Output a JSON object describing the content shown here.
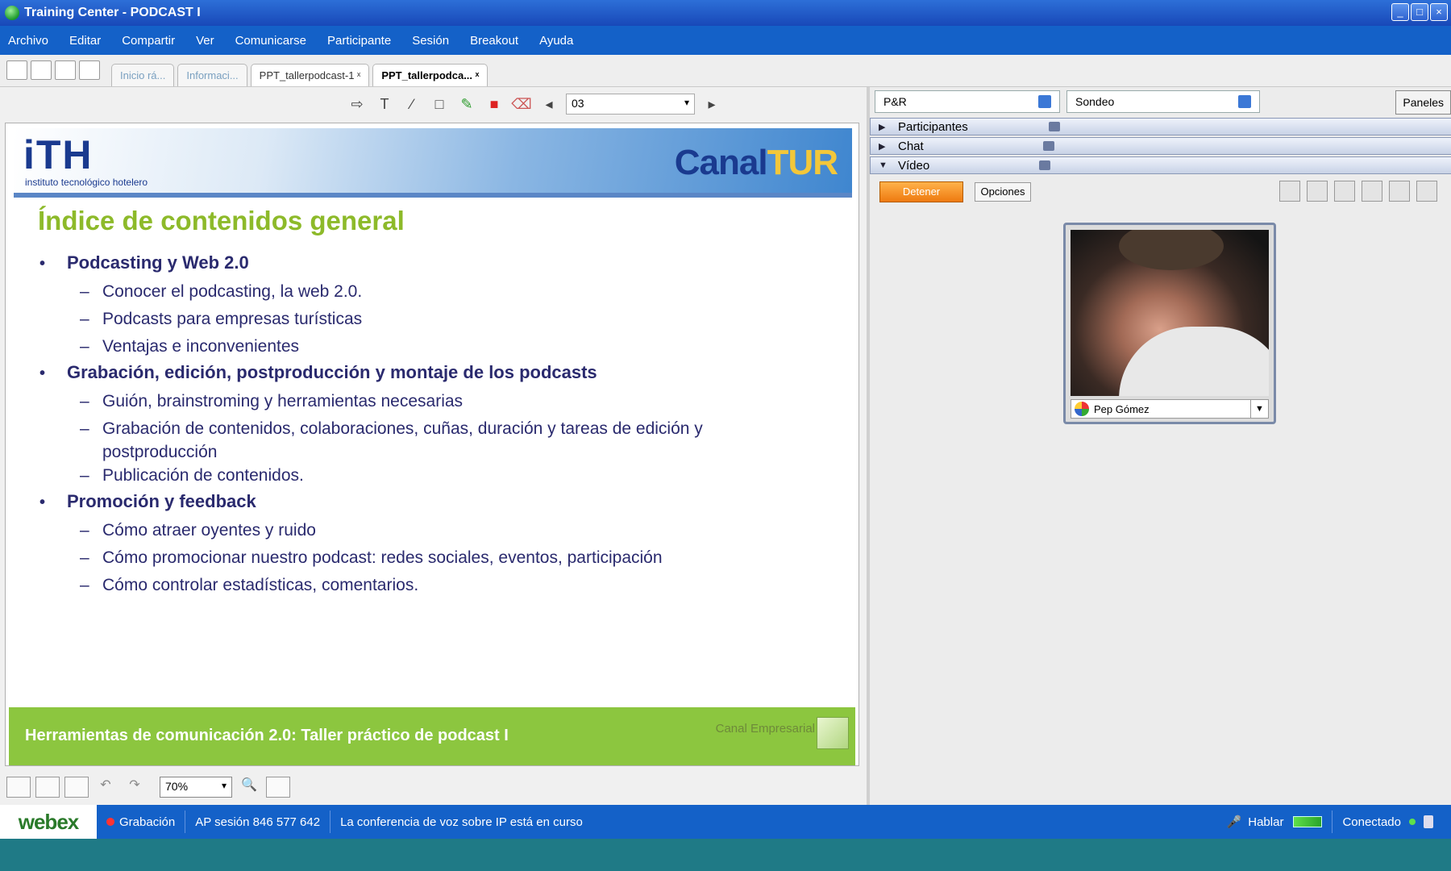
{
  "window": {
    "title": "Training Center - PODCAST I"
  },
  "menu": [
    "Archivo",
    "Editar",
    "Compartir",
    "Ver",
    "Comunicarse",
    "Participante",
    "Sesión",
    "Breakout",
    "Ayuda"
  ],
  "tabs": [
    {
      "label": "Inicio rá...",
      "state": "dim"
    },
    {
      "label": "Informaci...",
      "state": "dim"
    },
    {
      "label": "PPT_tallerpodcast-1 ˣ",
      "state": "normal"
    },
    {
      "label": "PPT_tallerpodca... ˣ",
      "state": "active"
    }
  ],
  "annotation_toolbar": {
    "page_value": "03"
  },
  "slide": {
    "banner_logo": "iTH",
    "banner_logo_sub": "instituto tecnológico hotelero",
    "banner_brand_1": "Canal",
    "banner_brand_2": "TUR",
    "title": "Índice de contenidos general",
    "sections": [
      {
        "title": "Podcasting y Web 2.0",
        "items": [
          "Conocer el podcasting, la web 2.0.",
          "Podcasts para empresas turísticas",
          "Ventajas e inconvenientes"
        ]
      },
      {
        "title": "Grabación, edición, postproducción y montaje de los podcasts",
        "items": [
          "Guión, brainstroming y herramientas necesarias",
          "Grabación de contenidos, colaboraciones, cuñas, duración y tareas de edición y postproducción",
          "Publicación de contenidos."
        ]
      },
      {
        "title": "Promoción y feedback",
        "items": [
          "Cómo atraer oyentes y ruido",
          "Cómo promocionar nuestro podcast: redes sociales, eventos, participación",
          "Cómo controlar estadísticas, comentarios."
        ]
      }
    ],
    "footer_text": "Herramientas de comunicación 2.0: Taller práctico de podcast I",
    "footer_brand": "Canal Empresarial"
  },
  "bottom_toolbar": {
    "zoom": "70%"
  },
  "right_panel": {
    "qa_label": "P&R",
    "poll_label": "Sondeo",
    "panels_button": "Paneles",
    "panels": [
      "Participantes",
      "Chat",
      "Vídeo"
    ],
    "video_stop": "Detener",
    "video_options": "Opciones",
    "participant_name": "Pep Gómez"
  },
  "status_bar": {
    "brand": "webex",
    "recording": "Grabación",
    "session": "AP sesión 846 577 642",
    "voip": "La conferencia de voz sobre IP está en curso",
    "talk": "Hablar",
    "connected": "Conectado"
  },
  "colors": {
    "title_bar": "#2d6fd8",
    "menu_bar": "#1461c8",
    "slide_title": "#8dba2a",
    "slide_text": "#2a2a6e",
    "footer": "#8cc63f"
  }
}
